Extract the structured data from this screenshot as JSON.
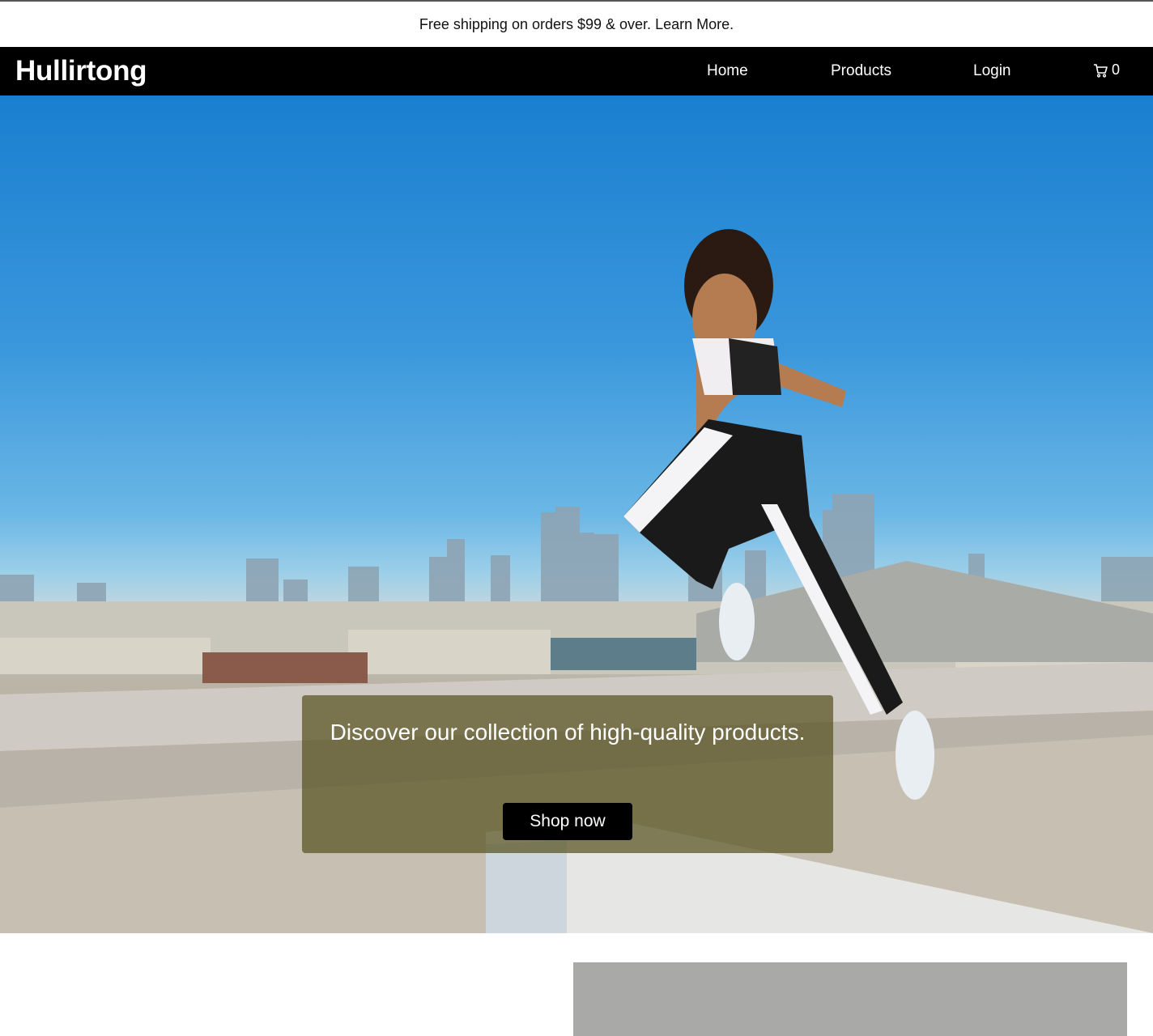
{
  "announcement": {
    "text": "Free shipping on orders $99 & over.",
    "link": "Learn More."
  },
  "navbar": {
    "brand": "Hullirtong",
    "links": [
      "Home",
      "Products",
      "Login"
    ],
    "cart_count": "0"
  },
  "hero": {
    "headline": "Discover our collection of high-quality products.",
    "cta": "Shop now"
  },
  "colors": {
    "navbar_bg": "#000000",
    "cta_bg": "#000000",
    "panel_overlay": "#585220"
  }
}
